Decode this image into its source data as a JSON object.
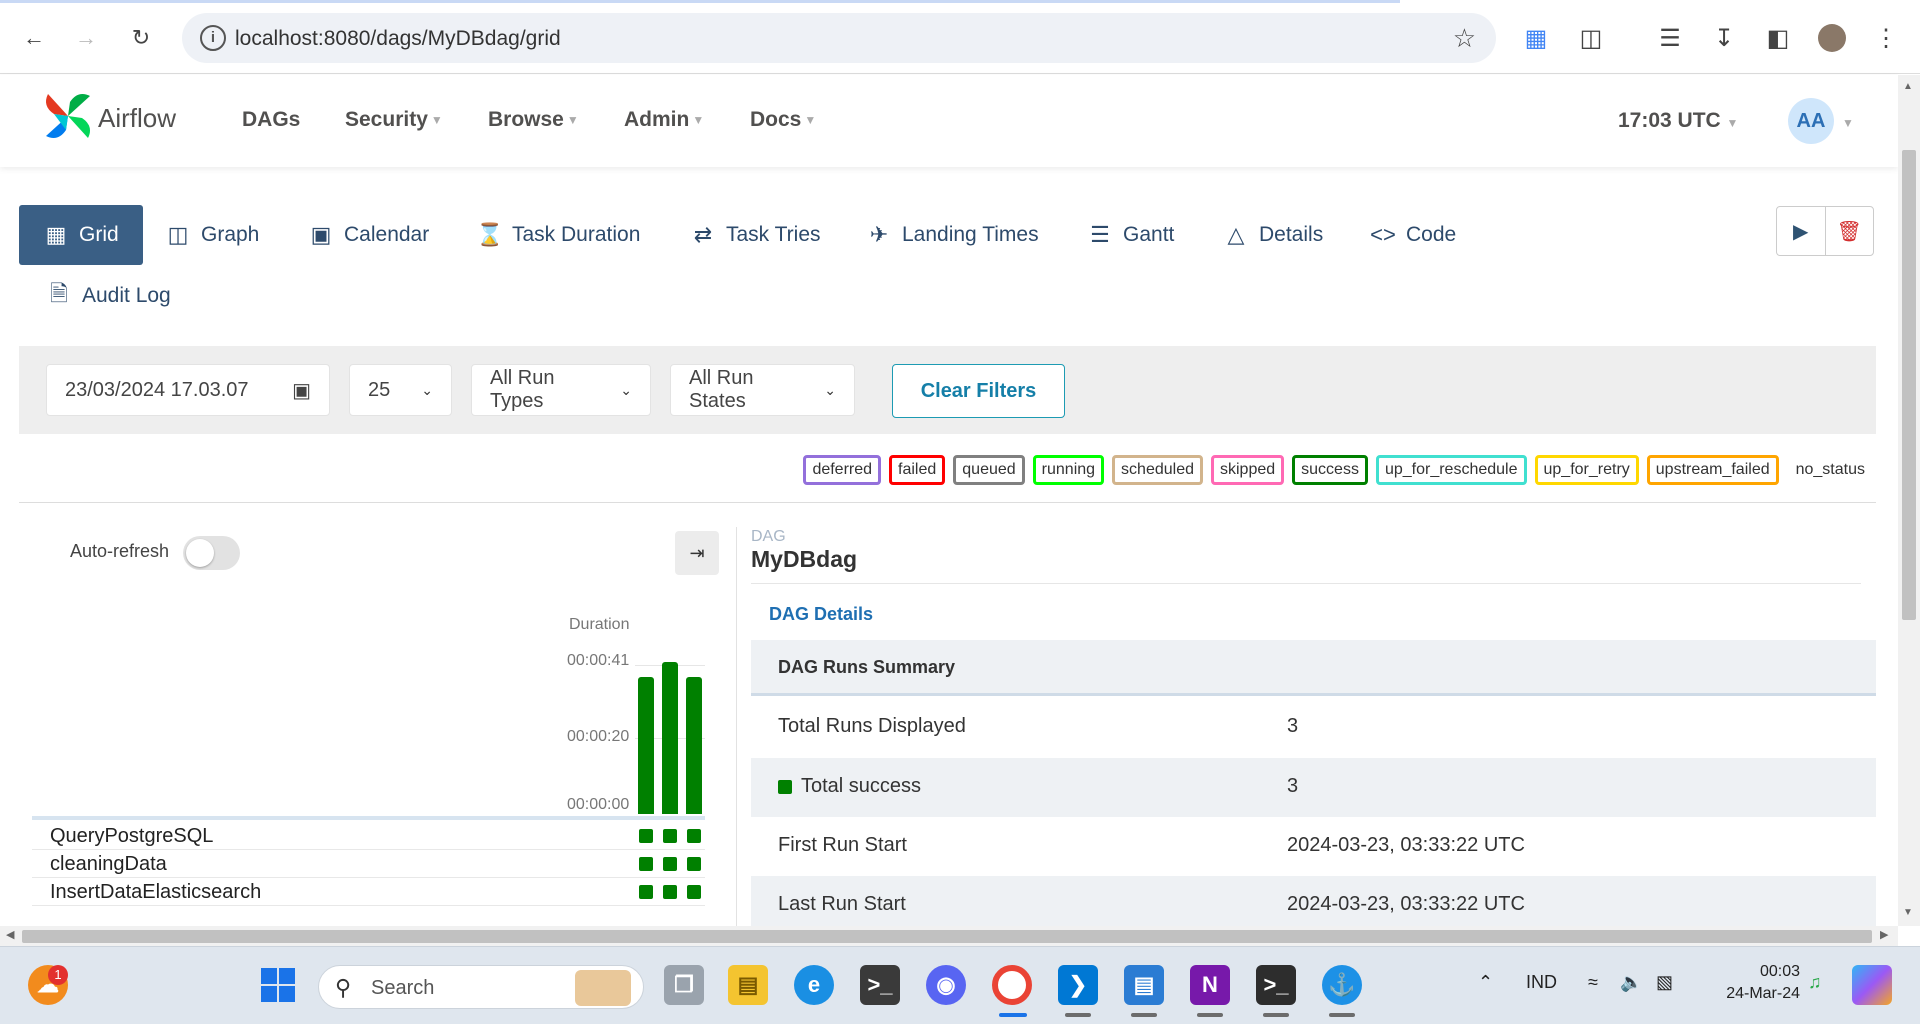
{
  "browser": {
    "url": "localhost:8080/dags/MyDBdag/grid"
  },
  "header": {
    "brand": "Airflow",
    "menu": [
      "DAGs",
      "Security",
      "Browse",
      "Admin",
      "Docs"
    ],
    "clock": "17:03 UTC",
    "avatar": "AA"
  },
  "tabs": [
    {
      "label": "Grid",
      "icon": "grid-icon",
      "active": true
    },
    {
      "label": "Graph",
      "icon": "graph-icon"
    },
    {
      "label": "Calendar",
      "icon": "calendar-icon"
    },
    {
      "label": "Task Duration",
      "icon": "hourglass-icon"
    },
    {
      "label": "Task Tries",
      "icon": "retry-icon"
    },
    {
      "label": "Landing Times",
      "icon": "plane-landing-icon"
    },
    {
      "label": "Gantt",
      "icon": "gantt-icon"
    },
    {
      "label": "Details",
      "icon": "warning-triangle-icon"
    },
    {
      "label": "Code",
      "icon": "code-icon"
    },
    {
      "label": "Audit Log",
      "icon": "audit-log-icon"
    }
  ],
  "filters": {
    "date": "23/03/2024  17.03.07",
    "num_runs": "25",
    "run_types": "All Run Types",
    "run_states": "All Run States",
    "clear_label": "Clear Filters"
  },
  "legend": [
    {
      "label": "deferred",
      "color": "#9370db"
    },
    {
      "label": "failed",
      "color": "#ff0000"
    },
    {
      "label": "queued",
      "color": "#808080"
    },
    {
      "label": "running",
      "color": "#00ff00"
    },
    {
      "label": "scheduled",
      "color": "#d2b48c"
    },
    {
      "label": "skipped",
      "color": "#ff69b4"
    },
    {
      "label": "success",
      "color": "#008000"
    },
    {
      "label": "up_for_reschedule",
      "color": "#40e0d0"
    },
    {
      "label": "up_for_retry",
      "color": "#ffd700"
    },
    {
      "label": "upstream_failed",
      "color": "#ffa500"
    },
    {
      "label": "no_status",
      "color": ""
    }
  ],
  "grid": {
    "auto_refresh_label": "Auto-refresh",
    "auto_refresh_on": false,
    "duration_label": "Duration",
    "ticks": [
      "00:00:41",
      "00:00:20",
      "00:00:00"
    ],
    "run_durations_seconds": [
      37,
      41,
      37
    ],
    "run_state_color": "#008000",
    "tasks": [
      "QueryPostgreSQL",
      "cleaningData",
      "InsertDataElasticsearch"
    ]
  },
  "details": {
    "kicker": "DAG",
    "dag_id": "MyDBdag",
    "details_link": "DAG Details",
    "summary_title": "DAG Runs Summary",
    "rows": [
      {
        "key": "Total Runs Displayed",
        "value": "3"
      },
      {
        "key": "Total success",
        "value": "3"
      },
      {
        "key": "First Run Start",
        "value": "2024-03-23, 03:33:22 UTC"
      },
      {
        "key": "Last Run Start",
        "value": "2024-03-23, 03:33:22 UTC"
      }
    ]
  },
  "taskbar": {
    "search_placeholder": "Search",
    "notification_count": "1",
    "language": "IND",
    "time": "00:03",
    "date": "24-Mar-24"
  }
}
